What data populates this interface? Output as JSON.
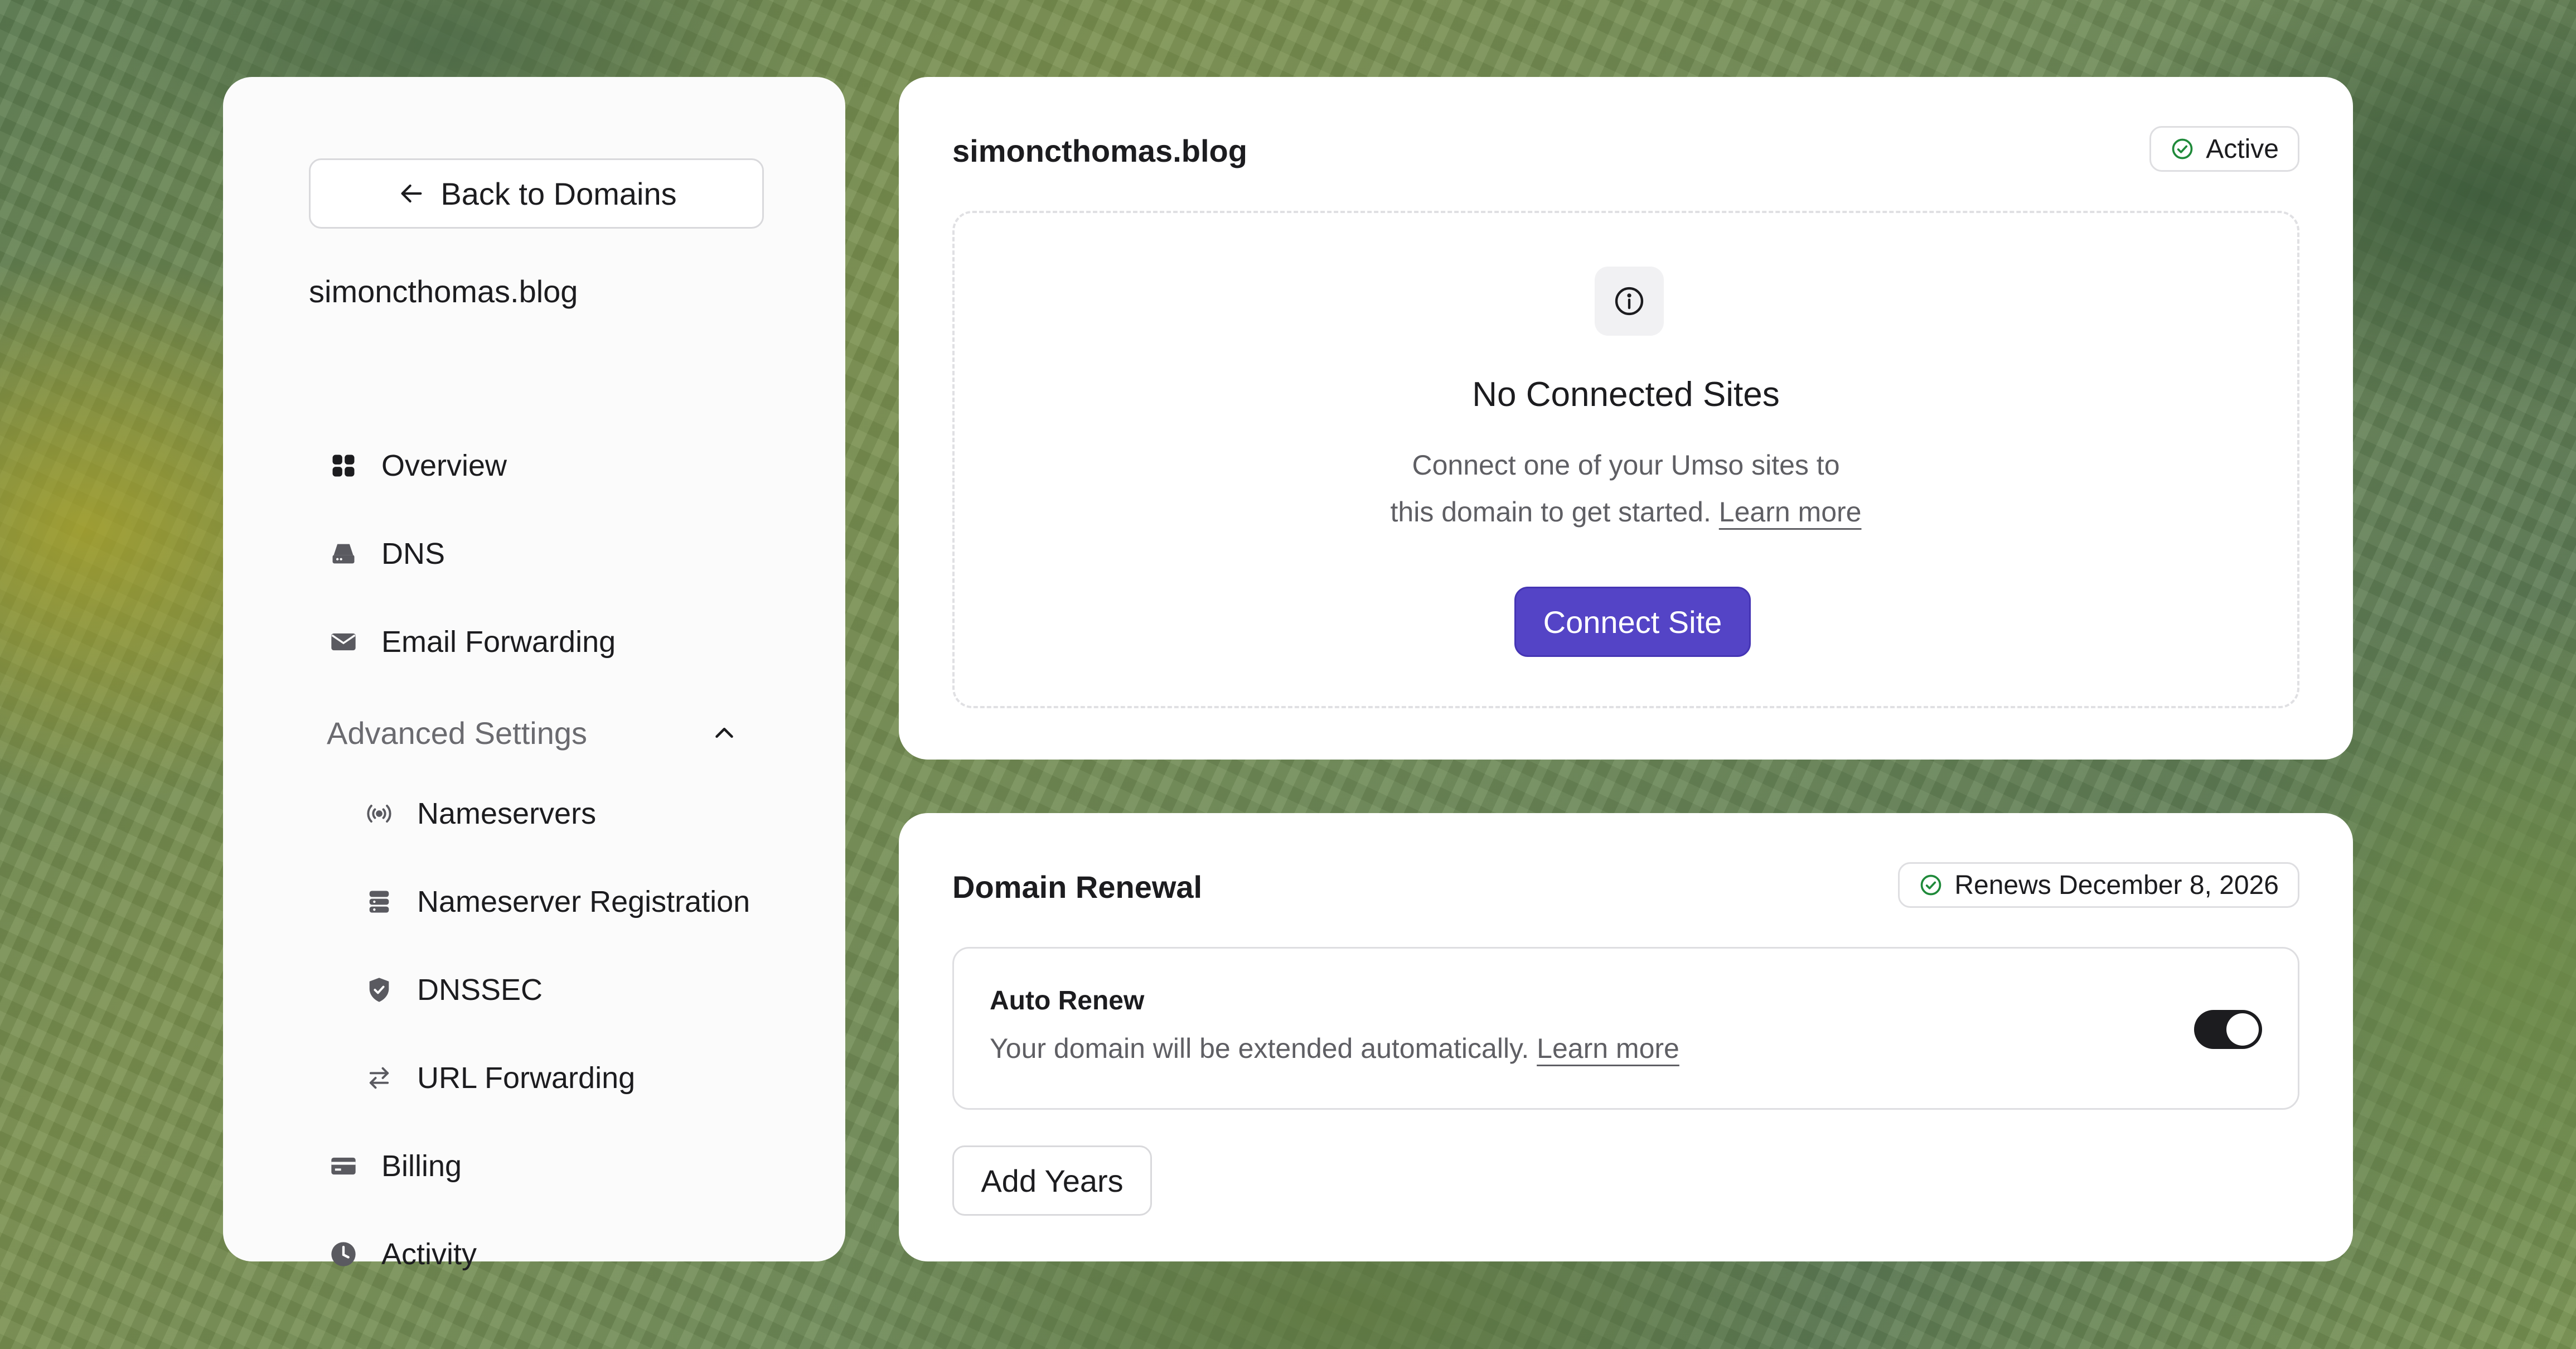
{
  "colors": {
    "accent": "#5444c6",
    "success": "#1f8a3a",
    "toggle_on": "#1c1c1f",
    "card_bg": "#ffffff",
    "sidebar_bg": "#fbfbfb"
  },
  "sidebar": {
    "back_button": {
      "label": "Back to Domains",
      "icon": "arrow-left-icon"
    },
    "domain": "simoncthomas.blog",
    "nav": {
      "overview": {
        "label": "Overview",
        "icon": "grid-icon"
      },
      "dns": {
        "label": "DNS",
        "icon": "server-icon"
      },
      "email_forwarding": {
        "label": "Email Forwarding",
        "icon": "envelope-icon"
      },
      "advanced": {
        "label": "Advanced Settings",
        "icon": "chevron-up-icon",
        "expanded": true
      },
      "nameservers": {
        "label": "Nameservers",
        "icon": "broadcast-icon"
      },
      "nameserver_registration": {
        "label": "Nameserver Registration",
        "icon": "database-icon"
      },
      "dnssec": {
        "label": "DNSSEC",
        "icon": "shield-check-icon"
      },
      "url_forwarding": {
        "label": "URL Forwarding",
        "icon": "arrows-swap-icon"
      },
      "billing": {
        "label": "Billing",
        "icon": "credit-card-icon"
      },
      "activity": {
        "label": "Activity",
        "icon": "clock-icon"
      }
    }
  },
  "sites_card": {
    "title": "simoncthomas.blog",
    "status": "Active",
    "empty_icon": "info-icon",
    "empty_title": "No Connected Sites",
    "empty_line1": "Connect one of your Umso sites to",
    "empty_line2": "this domain to get started.",
    "learn_more": "Learn more",
    "connect_button": "Connect Site"
  },
  "renewal_card": {
    "title": "Domain Renewal",
    "renews": "Renews December 8, 2026",
    "auto_renew": {
      "title": "Auto Renew",
      "description": "Your domain will be extended automatically.",
      "learn_more": "Learn more",
      "enabled": true
    },
    "add_years_button": "Add Years"
  }
}
